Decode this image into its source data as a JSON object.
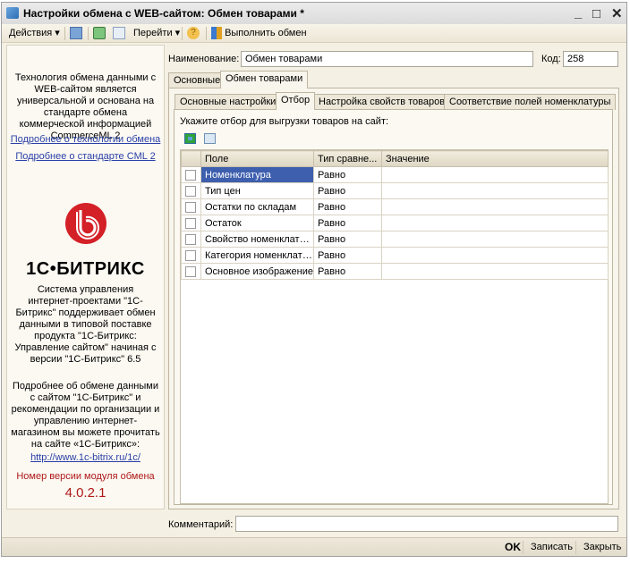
{
  "window": {
    "title": "Настройки обмена с WEB-сайтом: Обмен товарами *",
    "controls": {
      "minimize": "_",
      "maximize": "□",
      "close": "✕"
    }
  },
  "toolbar": {
    "actions": "Действия",
    "goto": "Перейти",
    "execute": "Выполнить обмен"
  },
  "left": {
    "intro": "Технология обмена данными с WEB-сайтом является универсальной и основана на стандарте обмена коммерческой информацией CommerceML 2",
    "link_tech": "Подробнее о технологии обмена",
    "link_cml": "Подробнее о стандарте CML 2",
    "logo_text": "1С•БИТРИКС",
    "logo_color": "#d42027",
    "desc": "Система управления интернет-проектами \"1С-Битрикс\" поддерживает обмен данными в типовой поставке продукта \"1С-Битрикс: Управление сайтом\" начиная с версии \"1С-Битрикс\" 6.5",
    "more": "Подробнее об обмене данными с сайтом \"1С-Битрикс\" и рекомендации по организации и управлению интернет-магазином вы можете прочитать на сайте «1С-Битрикс»:",
    "url": "http://www.1c-bitrix.ru/1c/",
    "version_label": "Номер версии модуля обмена",
    "version": "4.0.2.1"
  },
  "form": {
    "name_label": "Наименование:",
    "name_value": "Обмен товарами",
    "code_label": "Код:",
    "code_value": "258",
    "comment_label": "Комментарий:",
    "comment_value": ""
  },
  "tabs": [
    "Основные",
    "Обмен товарами"
  ],
  "subtabs": [
    "Основные настройки",
    "Отбор",
    "Настройка свойств товаров",
    "Соответствие полей номенклатуры"
  ],
  "filter": {
    "instruction": "Укажите отбор для выгрузки товаров на сайт:",
    "columns": [
      "Поле",
      "Тип сравне...",
      "Значение"
    ],
    "rows": [
      {
        "field": "Номенклатура",
        "cmp": "Равно",
        "value": "",
        "checked": false
      },
      {
        "field": "Тип цен",
        "cmp": "Равно",
        "value": "",
        "checked": false
      },
      {
        "field": "Остатки по складам",
        "cmp": "Равно",
        "value": "",
        "checked": false
      },
      {
        "field": "Остаток",
        "cmp": "Равно",
        "value": "",
        "checked": false
      },
      {
        "field": "Свойство номенклатуры",
        "cmp": "Равно",
        "value": "",
        "checked": false
      },
      {
        "field": "Категория номенклату...",
        "cmp": "Равно",
        "value": "",
        "checked": false
      },
      {
        "field": "Основное изображение",
        "cmp": "Равно",
        "value": "",
        "checked": false
      }
    ]
  },
  "buttons": {
    "ok": "OK",
    "save": "Записать",
    "close": "Закрыть"
  }
}
